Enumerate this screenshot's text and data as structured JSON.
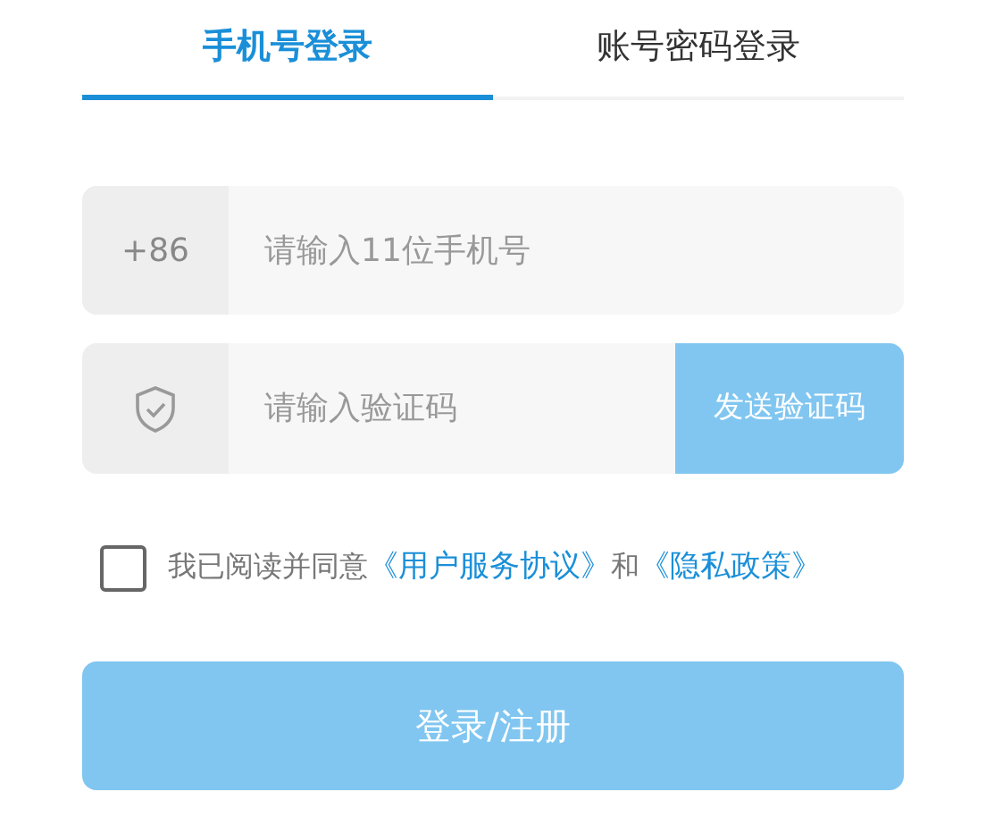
{
  "tabs": [
    {
      "label": "手机号登录",
      "selected": true
    },
    {
      "label": "账号密码登录",
      "selected": false
    }
  ],
  "phone": {
    "prefix": "+86",
    "placeholder": "请输入11位手机号"
  },
  "code": {
    "placeholder": "请输入验证码",
    "send_button": {
      "label": "发送验证码",
      "disabled": true
    }
  },
  "agreement": {
    "checked": false,
    "text": "我已阅读并同意",
    "links": [
      "《用户服务协议》",
      "《隐私政策》"
    ],
    "joiner": "和"
  },
  "submit": {
    "label": "登录/注册",
    "disabled": true
  }
}
